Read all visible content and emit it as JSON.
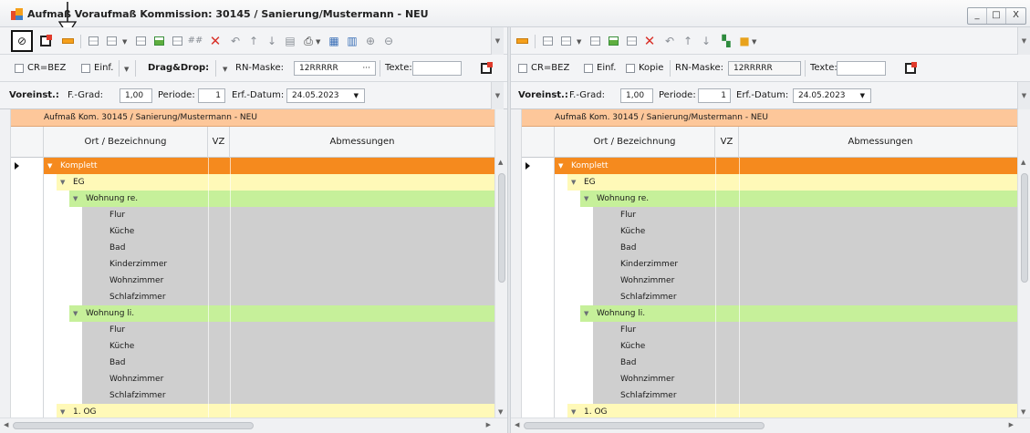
{
  "window": {
    "title": "Aufmaß Voraufmaß Kommission: 30145 / Sanierung/Mustermann - NEU",
    "minimize": "_",
    "maximize": "□",
    "close": "X"
  },
  "left": {
    "options": {
      "cr_bez": "CR=BEZ",
      "einf": "Einf.",
      "dragdrop": "Drag&Drop:",
      "rn_maske_label": "RN-Maske:",
      "rn_maske_value": "12RRRRR",
      "rn_maske_btn": "···",
      "texte_label": "Texte:"
    },
    "presets": {
      "voreinst": "Voreinst.:",
      "fgrad_label": "F.-Grad:",
      "fgrad_value": "1,00",
      "periode_label": "Periode:",
      "periode_value": "1",
      "erf_label": "Erf.-Datum:",
      "erf_value": "24.05.2023"
    },
    "grid_header": "Aufmaß Kom. 30145 / Sanierung/Mustermann - NEU",
    "columns": [
      "Ort / Bezeichnung",
      "VZ",
      "Abmessungen"
    ]
  },
  "right": {
    "options": {
      "cr_bez": "CR=BEZ",
      "einf": "Einf.",
      "kopie": "Kopie",
      "rn_maske_label": "RN-Maske:",
      "rn_maske_value": "12RRRRR",
      "texte_label": "Texte:"
    },
    "presets": {
      "voreinst": "Voreinst.:",
      "fgrad_label": "F.-Grad:",
      "fgrad_value": "1,00",
      "periode_label": "Periode:",
      "periode_value": "1",
      "erf_label": "Erf.-Datum:",
      "erf_value": "24.05.2023"
    },
    "grid_header": "Aufmaß Kom. 30145 / Sanierung/Mustermann - NEU",
    "columns": [
      "Ort / Bezeichnung",
      "VZ",
      "Abmessungen"
    ]
  },
  "tree_rows": [
    {
      "label": "Komplett",
      "level": 0,
      "kind": "root",
      "toggle": true
    },
    {
      "label": "EG",
      "level": 1,
      "kind": "floor",
      "toggle": true
    },
    {
      "label": "Wohnung re.",
      "level": 2,
      "kind": "unit",
      "toggle": true
    },
    {
      "label": "Flur",
      "level": 3,
      "kind": "room",
      "toggle": false
    },
    {
      "label": "Küche",
      "level": 3,
      "kind": "room",
      "toggle": false
    },
    {
      "label": "Bad",
      "level": 3,
      "kind": "room",
      "toggle": false
    },
    {
      "label": "Kinderzimmer",
      "level": 3,
      "kind": "room",
      "toggle": false
    },
    {
      "label": "Wohnzimmer",
      "level": 3,
      "kind": "room",
      "toggle": false
    },
    {
      "label": "Schlafzimmer",
      "level": 3,
      "kind": "room",
      "toggle": false
    },
    {
      "label": "Wohnung li.",
      "level": 2,
      "kind": "unit",
      "toggle": true
    },
    {
      "label": "Flur",
      "level": 3,
      "kind": "room",
      "toggle": false
    },
    {
      "label": "Küche",
      "level": 3,
      "kind": "room",
      "toggle": false
    },
    {
      "label": "Bad",
      "level": 3,
      "kind": "room",
      "toggle": false
    },
    {
      "label": "Wohnzimmer",
      "level": 3,
      "kind": "room",
      "toggle": false
    },
    {
      "label": "Schlafzimmer",
      "level": 3,
      "kind": "room",
      "toggle": false
    },
    {
      "label": "1. OG",
      "level": 1,
      "kind": "floor",
      "toggle": true
    }
  ],
  "colors": {
    "root": "#f58a1e",
    "floor": "#fff9b8",
    "unit": "#c6f09a",
    "room": "#cfcfcf",
    "grid_header": "#fdc79a"
  }
}
